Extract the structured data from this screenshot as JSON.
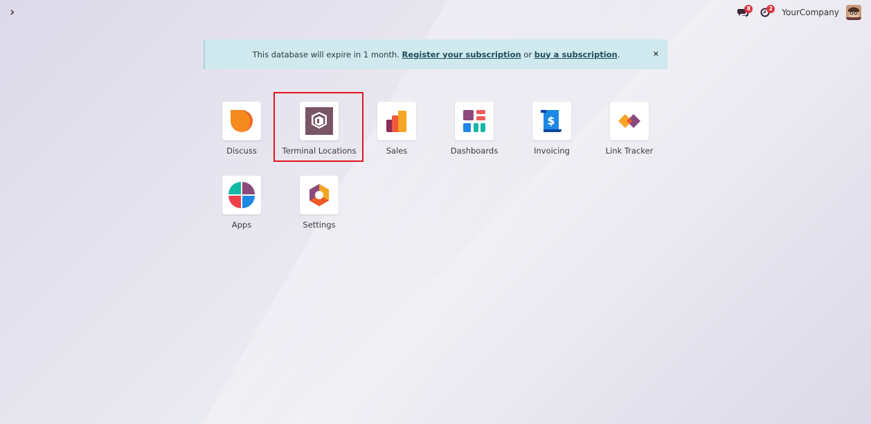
{
  "topbar": {
    "menu_toggle_glyph": "›",
    "messages_badge": "8",
    "activities_badge": "2",
    "company": "YourCompany"
  },
  "banner": {
    "text_before": "This database will expire in 1 month. ",
    "register_link": "Register your subscription",
    "text_middle": " or ",
    "buy_link": "buy a subscription",
    "text_after": ".",
    "close": "×"
  },
  "apps": [
    {
      "label": "Discuss",
      "icon": "discuss-icon"
    },
    {
      "label": "Terminal Locations",
      "icon": "terminal-locations-icon"
    },
    {
      "label": "Sales",
      "icon": "sales-icon"
    },
    {
      "label": "Dashboards",
      "icon": "dashboards-icon"
    },
    {
      "label": "Invoicing",
      "icon": "invoicing-icon"
    },
    {
      "label": "Link Tracker",
      "icon": "link-tracker-icon"
    },
    {
      "label": "Apps",
      "icon": "apps-icon"
    },
    {
      "label": "Settings",
      "icon": "settings-icon"
    }
  ],
  "colors": {
    "highlight": "#e0141e",
    "badge": "#d9323f",
    "banner_bg": "#cfe9ee"
  }
}
